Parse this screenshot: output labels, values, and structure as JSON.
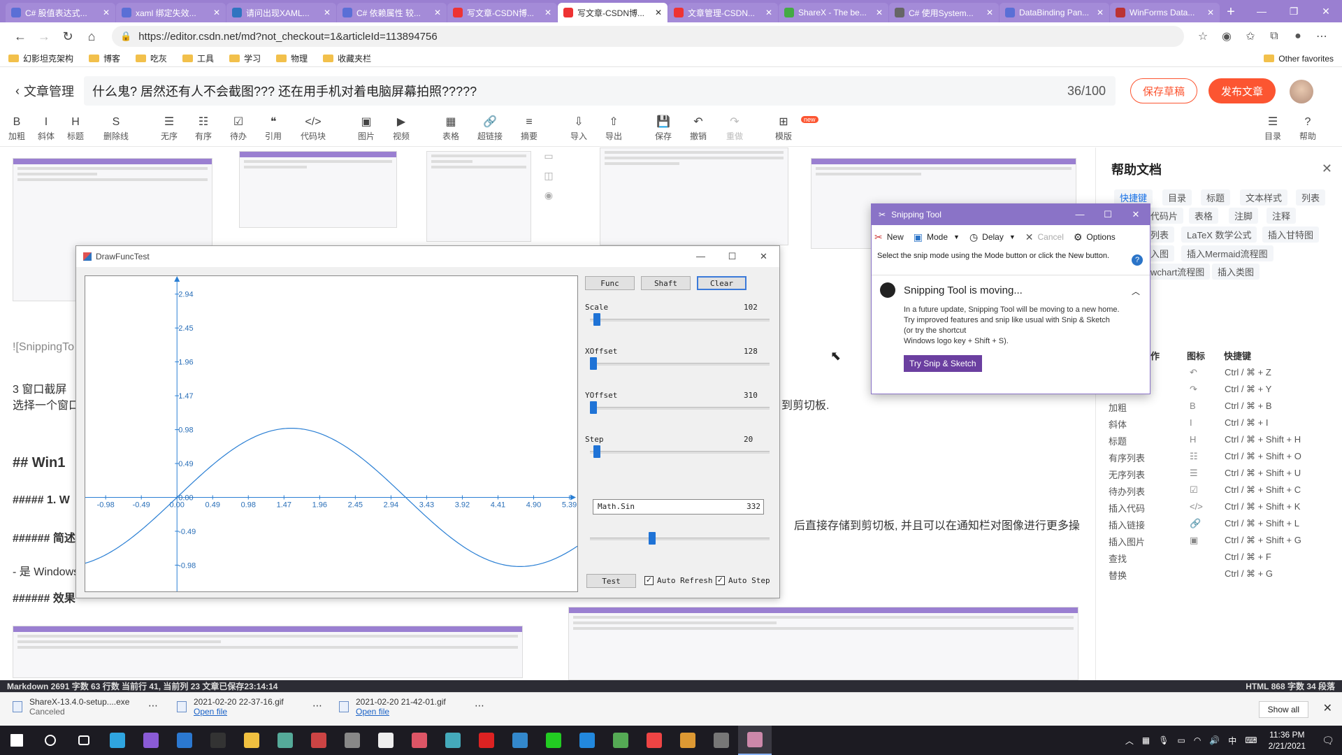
{
  "browser": {
    "tabs": [
      {
        "label": "C# 股值表达式...",
        "color": "#5a6fd6",
        "icon": "edge-doc-icon"
      },
      {
        "label": "xaml 绑定失效...",
        "color": "#5a6fd6",
        "icon": "edge-doc-icon"
      },
      {
        "label": "请问出现XAML...",
        "color": "#2f74c0",
        "icon": "edge-doc-icon"
      },
      {
        "label": "C# 依赖属性 较...",
        "color": "#5a6fd6",
        "icon": "edge-doc-icon"
      },
      {
        "label": "写文章-CSDN博...",
        "color": "#e33",
        "icon": "csdn-icon"
      },
      {
        "label": "写文章-CSDN博...",
        "color": "#e33",
        "icon": "csdn-icon"
      },
      {
        "label": "文章管理-CSDN...",
        "color": "#e33",
        "icon": "csdn-icon"
      },
      {
        "label": "ShareX - The be...",
        "color": "#44aa44",
        "icon": "sharex-icon"
      },
      {
        "label": "C# 使用System...",
        "color": "#666",
        "icon": "github-icon"
      },
      {
        "label": "DataBinding Pan...",
        "color": "#5a6fd6",
        "icon": "edge-doc-icon"
      },
      {
        "label": "WinForms Data...",
        "color": "#b33",
        "icon": "w-icon"
      }
    ],
    "active_tab": 5,
    "new_tab_glyph": "+",
    "url": "https://editor.csdn.net/md?not_checkout=1&articleId=113894756",
    "bookmarks": [
      "幻影坦克架构",
      "博客",
      "吃灰",
      "工具",
      "学习",
      "物理",
      "收藏夹栏"
    ],
    "other_favorites": "Other favorites"
  },
  "editor": {
    "back_label": "文章管理",
    "title": "什么鬼? 居然还有人不会截图??? 还在用手机对着电脑屏幕拍照?????",
    "title_count": "36/100",
    "save_draft": "保存草稿",
    "publish": "发布文章",
    "toolbar": [
      {
        "icon": "B",
        "label": "加粗",
        "x": 20
      },
      {
        "icon": "I",
        "label": "斜体",
        "x": 62
      },
      {
        "icon": "H",
        "label": "标题",
        "x": 104
      },
      {
        "icon": "S",
        "label": "删除线",
        "x": 162
      },
      {
        "icon": "☰",
        "label": "无序",
        "x": 238
      },
      {
        "icon": "☷",
        "label": "有序",
        "x": 287
      },
      {
        "icon": "☑",
        "label": "待办",
        "x": 337
      },
      {
        "icon": "❝",
        "label": "引用",
        "x": 387
      },
      {
        "icon": "</>",
        "label": "代码块",
        "x": 444
      },
      {
        "icon": "▣",
        "label": "图片",
        "x": 520
      },
      {
        "icon": "▶",
        "label": "视频",
        "x": 570
      },
      {
        "icon": "▦",
        "label": "表格",
        "x": 641
      },
      {
        "icon": "🔗",
        "label": "超链接",
        "x": 697
      },
      {
        "icon": "≡",
        "label": "摘要",
        "x": 753
      },
      {
        "icon": "⇩",
        "label": "导入",
        "x": 824
      },
      {
        "icon": "⇧",
        "label": "导出",
        "x": 874
      },
      {
        "icon": "💾",
        "label": "保存",
        "x": 945
      },
      {
        "icon": "↶",
        "label": "撤销",
        "x": 995
      },
      {
        "icon": "↷",
        "label": "重做",
        "x": 1047,
        "disabled": true
      },
      {
        "icon": "⊞",
        "label": "模版",
        "x": 1117
      },
      {
        "icon": "☰",
        "label": "目录",
        "x": 1817
      },
      {
        "icon": "?",
        "label": "帮助",
        "x": 1867
      }
    ],
    "new_badge": "new",
    "content_texts": [
      {
        "text": "![SnippingTo",
        "gray": true
      },
      {
        "text": "3  窗口截屏"
      },
      {
        "text": "选择一个窗口"
      },
      {
        "text": "到剪切板."
      },
      {
        "text": "## Win1",
        "bold": true
      },
      {
        "text": "##### 1. W",
        "bold": true
      },
      {
        "text": "###### 简述",
        "bold": true
      },
      {
        "text": "- 是 Windows"
      },
      {
        "text": "###### 效果",
        "bold": true
      },
      {
        "text": "后直接存储到剪切板, 并且可以在通知栏对图像进行更多操"
      }
    ]
  },
  "help": {
    "title": "帮助文档",
    "tags": [
      {
        "text": "快捷键",
        "active": true
      },
      {
        "text": "目录"
      },
      {
        "text": "标题"
      },
      {
        "text": "文本样式"
      },
      {
        "text": "列表"
      },
      {
        "text": "代码片"
      },
      {
        "text": "表格"
      },
      {
        "text": "注脚"
      },
      {
        "text": "注释"
      },
      {
        "text": "列表"
      },
      {
        "text": "LaTeX 数学公式"
      },
      {
        "text": "插入甘特图"
      },
      {
        "text": "入图"
      },
      {
        "text": "插入Mermaid流程图"
      },
      {
        "text": "wchart流程图"
      },
      {
        "text": "插入类图"
      }
    ],
    "headers": {
      "name": "作",
      "icon": "图标",
      "key": "快捷键"
    },
    "shortcuts": [
      {
        "name": "",
        "icon": "↶",
        "key": "Ctrl / ⌘ + Z"
      },
      {
        "name": "",
        "icon": "↷",
        "key": "Ctrl / ⌘ + Y"
      },
      {
        "name": "加粗",
        "icon": "B",
        "key": "Ctrl / ⌘ + B"
      },
      {
        "name": "斜体",
        "icon": "I",
        "key": "Ctrl / ⌘ + I"
      },
      {
        "name": "标题",
        "icon": "H",
        "key": "Ctrl / ⌘ + Shift + H"
      },
      {
        "name": "有序列表",
        "icon": "☷",
        "key": "Ctrl / ⌘ + Shift + O"
      },
      {
        "name": "无序列表",
        "icon": "☰",
        "key": "Ctrl / ⌘ + Shift + U"
      },
      {
        "name": "待办列表",
        "icon": "☑",
        "key": "Ctrl / ⌘ + Shift + C"
      },
      {
        "name": "插入代码",
        "icon": "</>",
        "key": "Ctrl / ⌘ + Shift + K"
      },
      {
        "name": "插入链接",
        "icon": "🔗",
        "key": "Ctrl / ⌘ + Shift + L"
      },
      {
        "name": "插入图片",
        "icon": "▣",
        "key": "Ctrl / ⌘ + Shift + G"
      },
      {
        "name": "查找",
        "icon": "",
        "key": "Ctrl / ⌘ + F"
      },
      {
        "name": "替换",
        "icon": "",
        "key": "Ctrl / ⌘ + G"
      }
    ]
  },
  "snip": {
    "title": "Snipping Tool",
    "buttons": {
      "new": "New",
      "mode": "Mode",
      "delay": "Delay",
      "cancel": "Cancel",
      "options": "Options"
    },
    "message": "Select the snip mode using the Mode button or click the New button.",
    "notice_title": "Snipping Tool is moving...",
    "notice_body": [
      "In a future update, Snipping Tool will be moving to a new home. Try improved features and snip like usual with Snip & Sketch (or try the shortcut",
      "Windows logo key + Shift + S)."
    ],
    "try_button": "Try Snip & Sketch"
  },
  "dft": {
    "title": "DrawFuncTest",
    "buttons": {
      "func": "Func",
      "shaft": "Shaft",
      "clear": "Clear",
      "test": "Test"
    },
    "sliders": [
      {
        "label": "Scale",
        "value": "102",
        "fraction": 0.02
      },
      {
        "label": "XOffset",
        "value": "128",
        "fraction": 0.0
      },
      {
        "label": "YOffset",
        "value": "310",
        "fraction": 0.0
      },
      {
        "label": "Step",
        "value": "20",
        "fraction": 0.02
      }
    ],
    "expression": "Math.Sin",
    "expression_value": "332",
    "expression_slider_fraction": 0.34,
    "auto_refresh": "Auto Refresh",
    "auto_step": "Auto Step",
    "checked_glyph": "✓"
  },
  "chart_data": {
    "type": "line",
    "function": "sin",
    "x_ticks": [
      "-0.98",
      "-0.49",
      "0.00",
      "0.49",
      "0.98",
      "1.47",
      "1.96",
      "2.45",
      "2.94",
      "3.43",
      "3.92",
      "4.41",
      "4.90",
      "5.39"
    ],
    "y_ticks": [
      "2.94",
      "2.45",
      "1.96",
      "1.47",
      "0.98",
      "0.49",
      "0.00",
      "-0.49",
      "-0.98"
    ],
    "xlim": [
      -1.26,
      5.5
    ],
    "ylim": [
      -1.36,
      3.2
    ],
    "series": [
      {
        "x_range": [
          -1.26,
          5.5
        ],
        "formula": "sin(x)"
      }
    ]
  },
  "statusbar": {
    "left": "Markdown  2691 字数  63 行数  当前行 41, 当前列 23  文章已保存23:14:14",
    "right": "HTML  868 字数  34 段落"
  },
  "downloads": [
    {
      "name": "ShareX-13.4.0-setup....exe",
      "sub": "Canceled",
      "link": false
    },
    {
      "name": "2021-02-20 22-37-16.gif",
      "sub": "Open file",
      "link": true
    },
    {
      "name": "2021-02-20 21-42-01.gif",
      "sub": "Open file",
      "link": true
    }
  ],
  "show_all": "Show all",
  "taskbar": {
    "apps": [
      {
        "icon": "windows-start-icon",
        "color": "#ffffff"
      },
      {
        "icon": "search-icon",
        "color": "#ffffff"
      },
      {
        "icon": "task-view-icon",
        "color": "#ffffff"
      },
      {
        "icon": "edge-icon",
        "color": "#2fa5e0"
      },
      {
        "icon": "visual-studio-icon",
        "color": "#8a5bd6"
      },
      {
        "icon": "vs-code-icon",
        "color": "#2b78d0"
      },
      {
        "icon": "terminal-icon",
        "color": "#333333"
      },
      {
        "icon": "file-explorer-icon",
        "color": "#f0c040"
      },
      {
        "icon": "app-icon",
        "color": "#5a9"
      },
      {
        "icon": "drawfunctest-icon",
        "color": "#c44"
      },
      {
        "icon": "app-icon",
        "color": "#888"
      },
      {
        "icon": "typora-icon",
        "color": "#eee"
      },
      {
        "icon": "app-icon",
        "color": "#d56"
      },
      {
        "icon": "app-icon",
        "color": "#4ab"
      },
      {
        "icon": "netease-music-icon",
        "color": "#d22"
      },
      {
        "icon": "app-icon",
        "color": "#38c"
      },
      {
        "icon": "wechat-icon",
        "color": "#2c2"
      },
      {
        "icon": "app-icon",
        "color": "#28d"
      },
      {
        "icon": "app-icon",
        "color": "#5a5"
      },
      {
        "icon": "chrome-icon",
        "color": "#e44"
      },
      {
        "icon": "app-icon",
        "color": "#d93"
      },
      {
        "icon": "app-icon",
        "color": "#777"
      },
      {
        "icon": "snipping-tool-icon",
        "color": "#c8a"
      }
    ],
    "active_app": 22,
    "ime": "中",
    "time": "11:36 PM",
    "date": "2/21/2021"
  }
}
